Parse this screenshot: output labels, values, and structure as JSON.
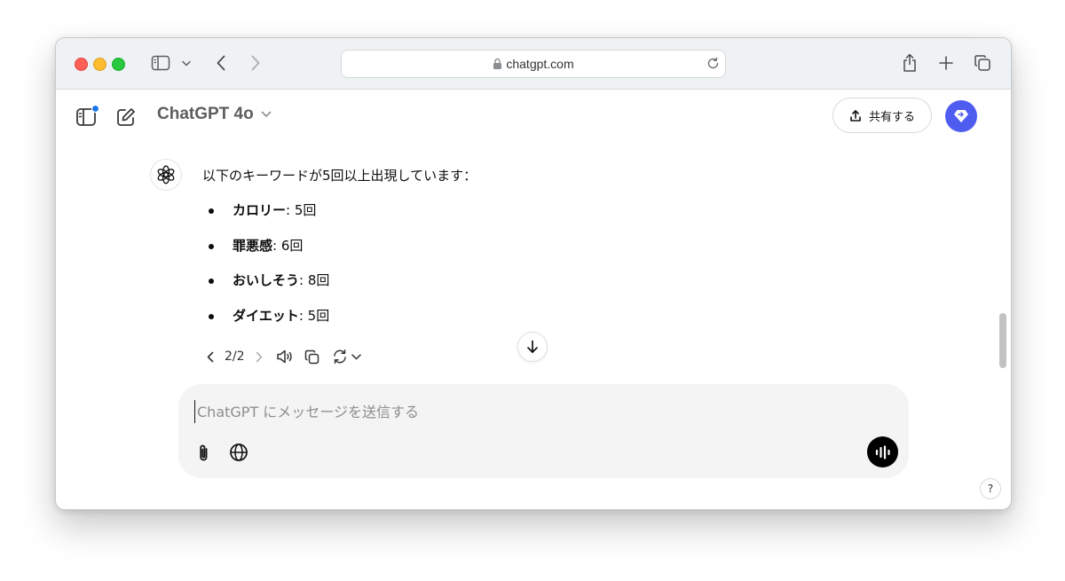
{
  "browser": {
    "url": "chatgpt.com"
  },
  "header": {
    "model_name": "ChatGPT 4o",
    "share_label": "共有する"
  },
  "message": {
    "intro": "以下のキーワードが5回以上出現しています：",
    "items": [
      {
        "keyword": "カロリー",
        "count": ": 5回"
      },
      {
        "keyword": "罪悪感",
        "count": ": 6回"
      },
      {
        "keyword": "おいしそう",
        "count": ": 8回"
      },
      {
        "keyword": "ダイエット",
        "count": ": 5回"
      }
    ],
    "pager": "2/2"
  },
  "composer": {
    "placeholder": "ChatGPT にメッセージを送信する"
  },
  "help": {
    "label": "?"
  },
  "colors": {
    "avatar": "#4f5cf0",
    "notification_dot": "#1a73e8",
    "composer_bg": "#f4f4f4"
  }
}
